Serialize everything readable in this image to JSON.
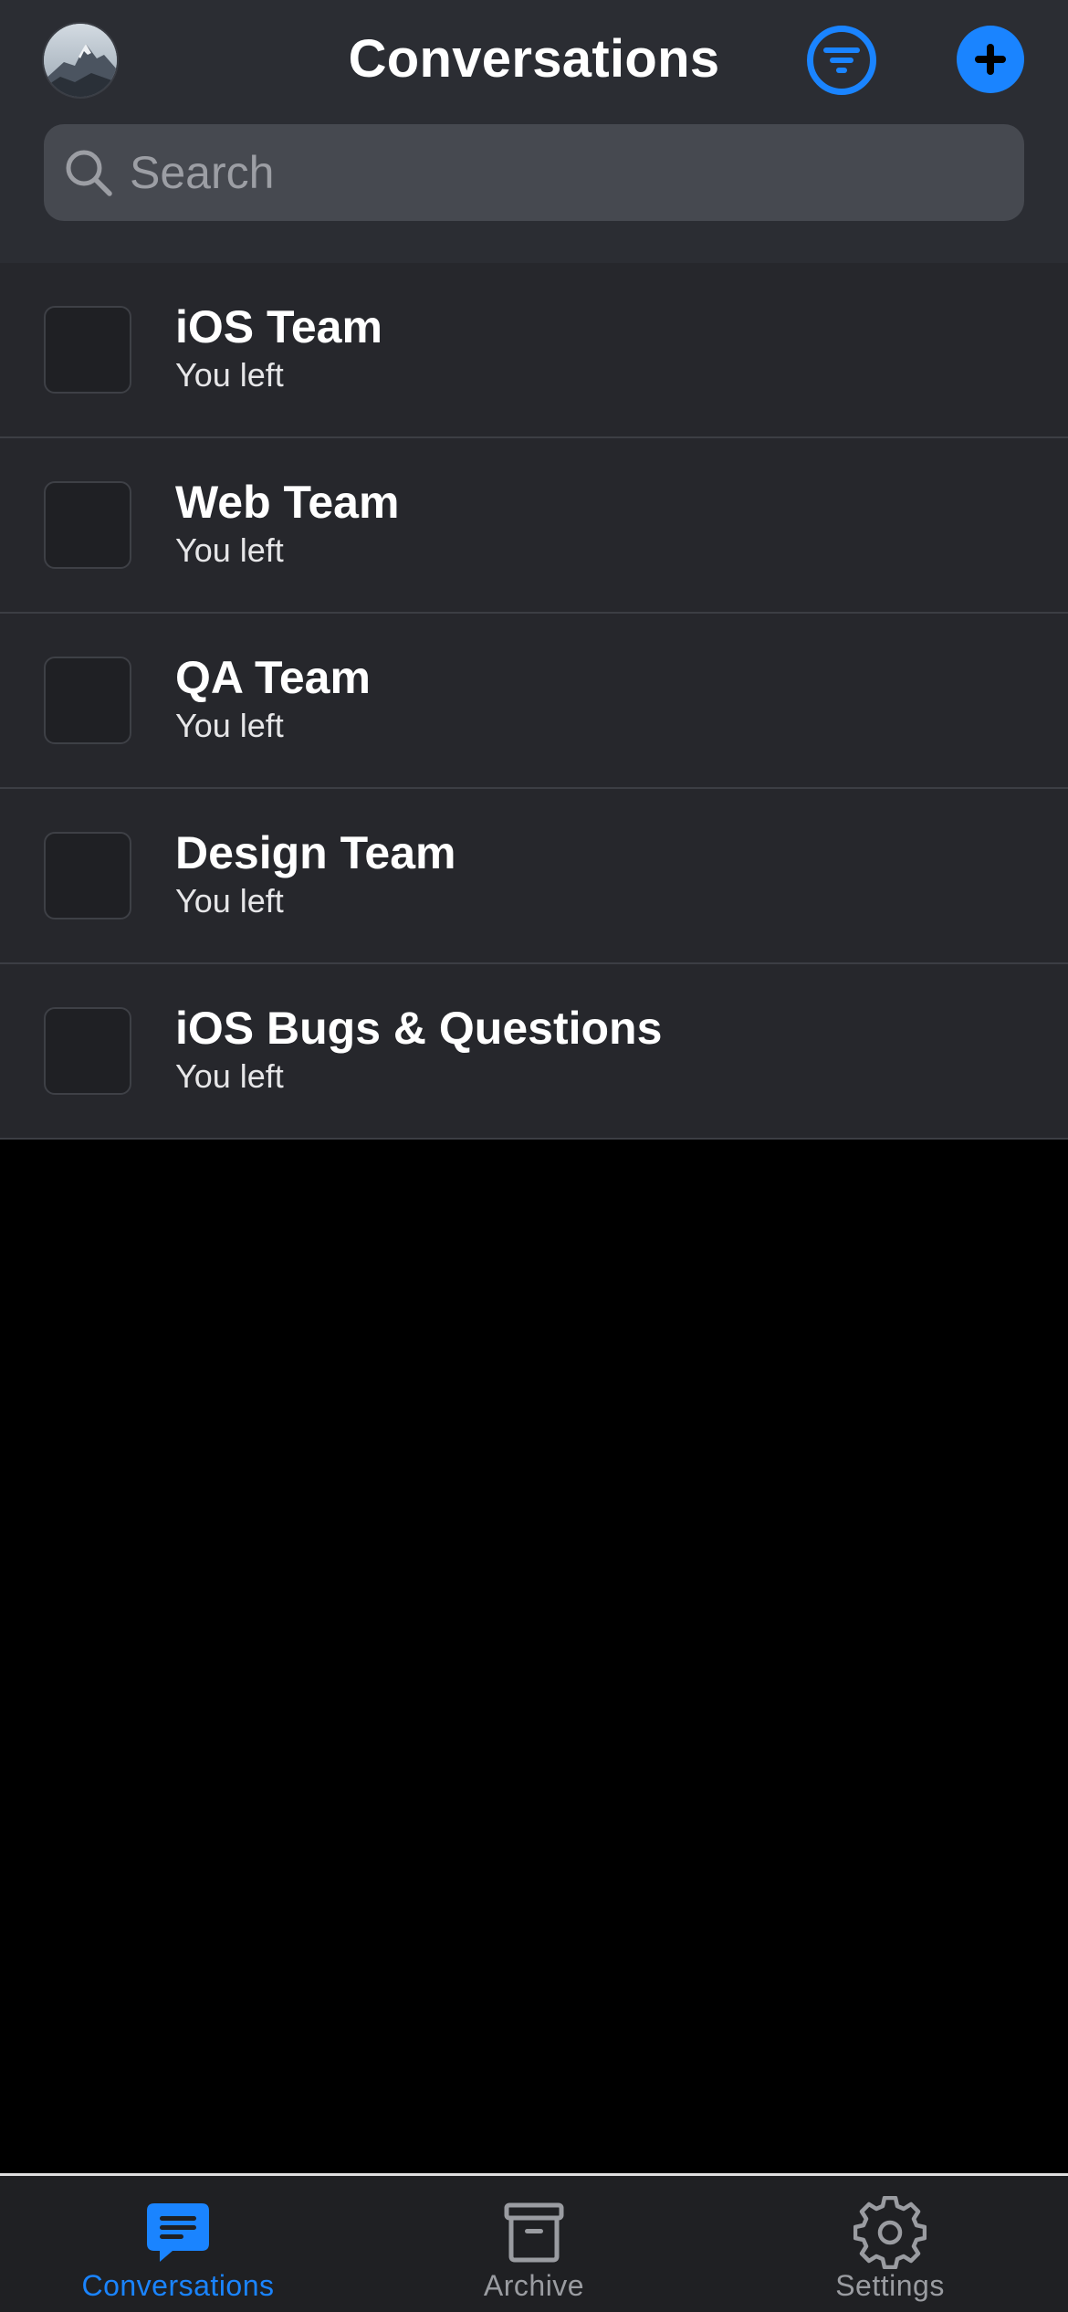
{
  "header": {
    "title": "Conversations",
    "avatar_icon": "mountain-avatar",
    "filter_icon": "filter-icon",
    "add_icon": "plus-icon"
  },
  "search": {
    "placeholder": "Search",
    "value": "",
    "icon": "search-icon"
  },
  "conversations": [
    {
      "name": "iOS Team",
      "status": "You left"
    },
    {
      "name": "Web Team",
      "status": "You left"
    },
    {
      "name": "QA Team",
      "status": "You left"
    },
    {
      "name": "Design Team",
      "status": "You left"
    },
    {
      "name": "iOS Bugs & Questions",
      "status": "You left"
    }
  ],
  "tabbar": {
    "tabs": [
      {
        "label": "Conversations",
        "icon": "chat-bubble-icon",
        "active": true
      },
      {
        "label": "Archive",
        "icon": "archive-box-icon",
        "active": false
      },
      {
        "label": "Settings",
        "icon": "gear-icon",
        "active": false
      }
    ]
  },
  "colors": {
    "accent": "#1a84ff",
    "header_bg": "#2b2d33",
    "row_bg": "#26272c",
    "background": "#000000"
  }
}
